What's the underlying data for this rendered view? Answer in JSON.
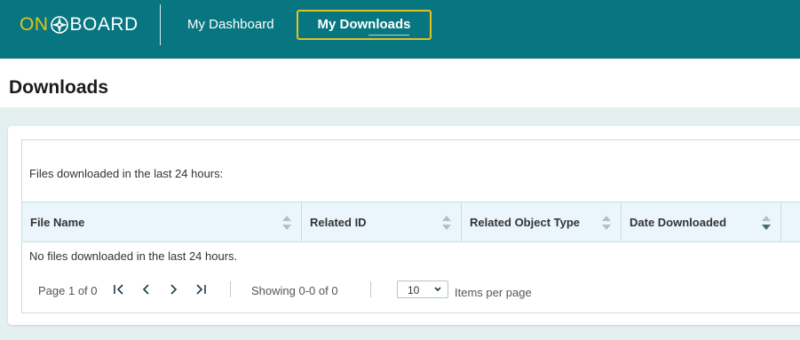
{
  "brand": {
    "logo_text_on": "ON",
    "logo_text_rest": "BOARD",
    "accent": "#e6c21e",
    "header_bg": "#077680"
  },
  "nav": {
    "dashboard_label": "My Dashboard",
    "downloads_label": "My Downloads"
  },
  "page": {
    "title": "Downloads"
  },
  "grid": {
    "caption": "Files downloaded in the last 24 hours:",
    "columns": [
      {
        "label": "File Name",
        "sort_icon": "sort-both-icon"
      },
      {
        "label": "Related ID",
        "sort_icon": "sort-both-icon"
      },
      {
        "label": "Related Object Type",
        "sort_icon": "sort-both-icon"
      },
      {
        "label": "Date Downloaded",
        "sort_icon": "sort-descending-icon"
      }
    ],
    "empty_message": "No files downloaded in the last 24 hours."
  },
  "pager": {
    "page_info": "Page 1 of 0",
    "showing": "Showing 0-0 of 0",
    "page_size": "10",
    "items_per_page_label": "Items per page"
  }
}
